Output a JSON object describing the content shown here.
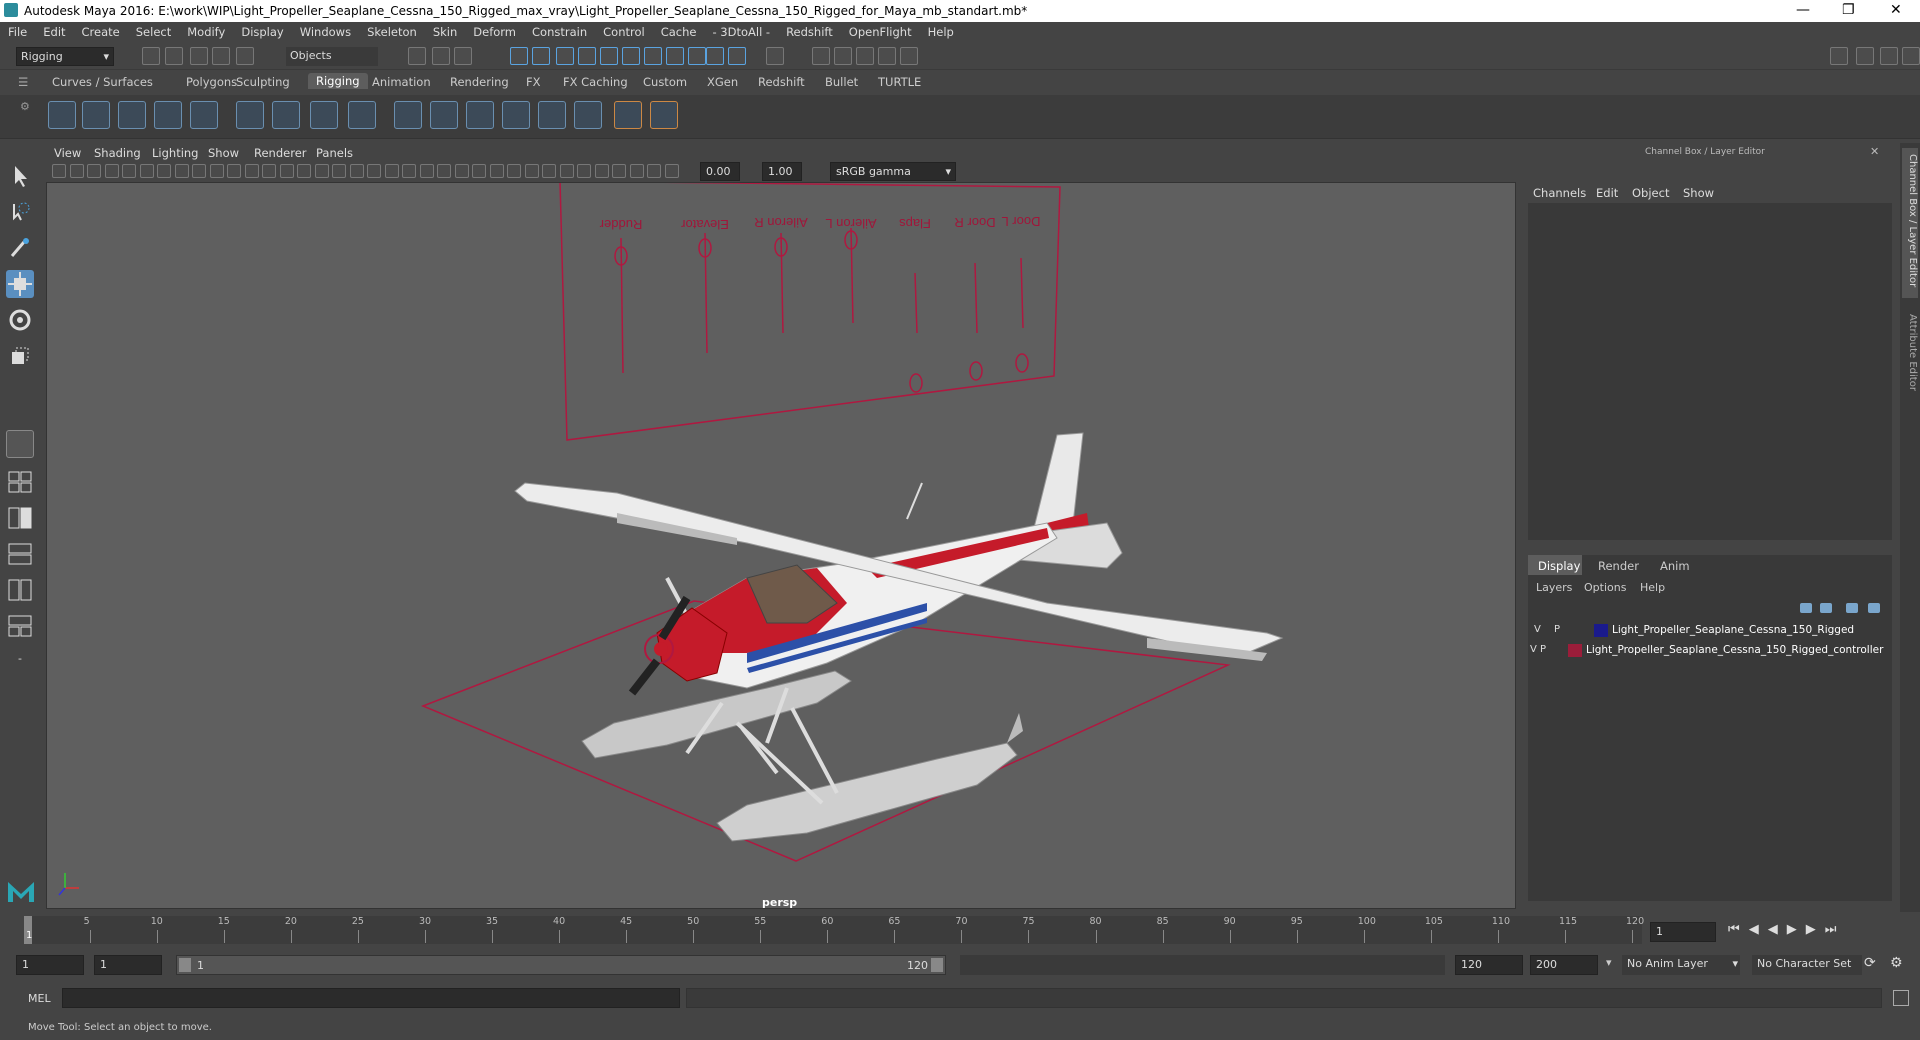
{
  "window": {
    "title": "Autodesk Maya 2016: E:\\work\\WIP\\Light_Propeller_Seaplane_Cessna_150_Rigged_max_vray\\Light_Propeller_Seaplane_Cessna_150_Rigged_for_Maya_mb_standart.mb*"
  },
  "menubar": [
    "File",
    "Edit",
    "Create",
    "Select",
    "Modify",
    "Display",
    "Windows",
    "Skeleton",
    "Skin",
    "Deform",
    "Constrain",
    "Control",
    "Cache",
    "- 3DtoAll -",
    "Redshift",
    "OpenFlight",
    "Help"
  ],
  "status": {
    "mode": "Rigging",
    "selection_mode": "Objects"
  },
  "shelf_tabs": [
    "Curves / Surfaces",
    "Polygons",
    "Sculpting",
    "Rigging",
    "Animation",
    "Rendering",
    "FX",
    "FX Caching",
    "Custom",
    "XGen",
    "Redshift",
    "Bullet",
    "TURTLE"
  ],
  "active_shelf": "Rigging",
  "viewport": {
    "menu": [
      "View",
      "Shading",
      "Lighting",
      "Show",
      "Renderer",
      "Panels"
    ],
    "exposure": "0.00",
    "gamma": "1.00",
    "color_space": "sRGB gamma",
    "camera": "persp",
    "controller_labels": [
      "Rudder",
      "Elevator",
      "Aileron R",
      "Aileron L",
      "Flaps",
      "Door R",
      "Door L"
    ]
  },
  "channel_box": {
    "title": "Channel Box / Layer Editor",
    "menu": [
      "Channels",
      "Edit",
      "Object",
      "Show"
    ],
    "tabs": [
      "Display",
      "Render",
      "Anim"
    ],
    "layer_menu": [
      "Layers",
      "Options",
      "Help"
    ],
    "layers": [
      {
        "v": "V",
        "p": "P",
        "name": "Light_Propeller_Seaplane_Cessna_150_Rigged",
        "color": "#1a1a8c"
      },
      {
        "v": "V",
        "p": "P",
        "name": "Light_Propeller_Seaplane_Cessna_150_Rigged_controller",
        "color": "#9b1d3a"
      }
    ]
  },
  "side_tabs": [
    "Channel Box / Layer Editor",
    "Attribute Editor"
  ],
  "timeline": {
    "ticks": [
      "5",
      "10",
      "15",
      "20",
      "25",
      "30",
      "35",
      "40",
      "45",
      "50",
      "55",
      "60",
      "65",
      "70",
      "75",
      "80",
      "85",
      "90",
      "95",
      "100",
      "105",
      "110",
      "115",
      "120"
    ],
    "current_frame": "1",
    "start_marker": "1"
  },
  "range": {
    "start": "1",
    "playback_start": "1",
    "slider_start": "1",
    "slider_end": "120",
    "playback_end": "120",
    "end": "200",
    "anim_layer": "No Anim Layer",
    "char_set": "No Character Set"
  },
  "cmd": {
    "label": "MEL"
  },
  "help": "Move Tool: Select an object to move."
}
